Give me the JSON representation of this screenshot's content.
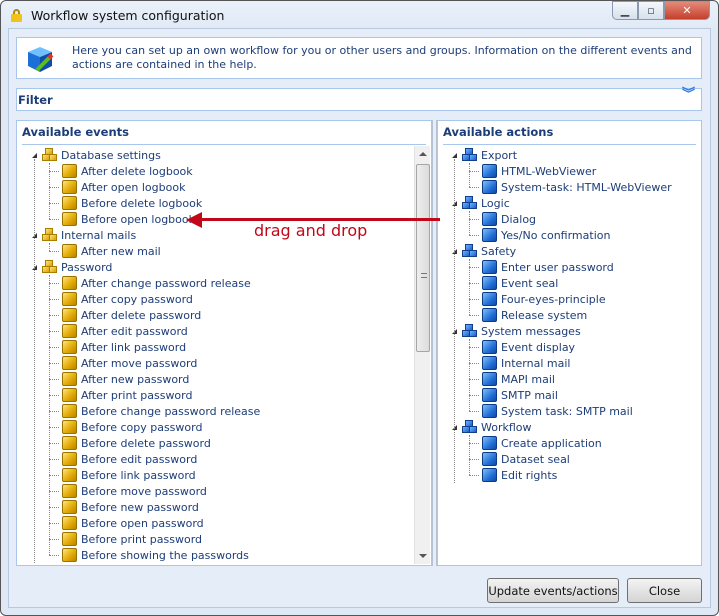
{
  "window": {
    "title": "Workflow system configuration",
    "controls": {
      "minimize": "minimize-icon",
      "maximize": "maximize-icon",
      "close": "close-icon"
    }
  },
  "info": {
    "text": "Here you can set up an own workflow for you or other users and groups. Information on the different events and actions are contained in the help."
  },
  "filter": {
    "label": "Filter"
  },
  "events": {
    "header": "Available events",
    "groups": [
      {
        "label": "Database settings",
        "items": [
          "After delete logbook",
          "After open logbook",
          "Before delete logbook",
          "Before open logbook"
        ]
      },
      {
        "label": "Internal mails",
        "items": [
          "After new mail"
        ]
      },
      {
        "label": "Password",
        "items": [
          "After change password release",
          "After copy password",
          "After delete password",
          "After edit password",
          "After link password",
          "After move password",
          "After new password",
          "After print password",
          "Before change password release",
          "Before copy password",
          "Before delete password",
          "Before edit password",
          "Before link password",
          "Before move password",
          "Before new password",
          "Before open password",
          "Before print password",
          "Before showing the passwords"
        ]
      }
    ]
  },
  "actions": {
    "header": "Available actions",
    "groups": [
      {
        "label": "Export",
        "items": [
          "HTML-WebViewer",
          "System-task: HTML-WebViewer"
        ]
      },
      {
        "label": "Logic",
        "items": [
          "Dialog",
          "Yes/No confirmation"
        ]
      },
      {
        "label": "Safety",
        "items": [
          "Enter user password",
          "Event seal",
          "Four-eyes-principle",
          "Release system"
        ]
      },
      {
        "label": "System messages",
        "items": [
          "Event display",
          "Internal mail",
          "MAPI mail",
          "SMTP mail",
          "System task: SMTP mail"
        ]
      },
      {
        "label": "Workflow",
        "items": [
          "Create application",
          "Dataset seal",
          "Edit rights"
        ]
      }
    ]
  },
  "annotation": {
    "text": "drag and drop",
    "color": "#c0081a"
  },
  "buttons": {
    "update": "Update events/actions",
    "close": "Close"
  }
}
